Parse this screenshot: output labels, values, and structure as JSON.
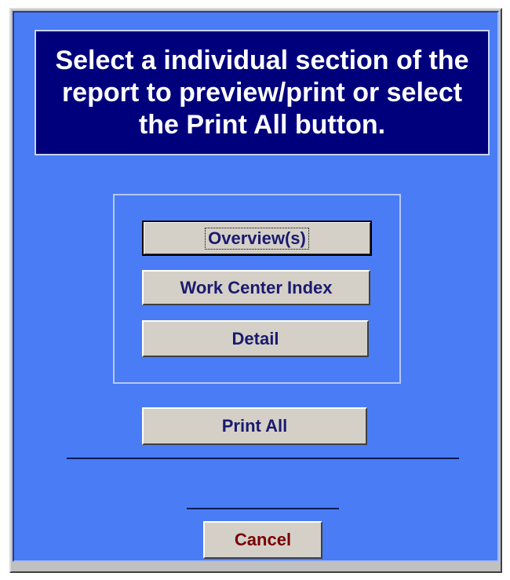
{
  "header": {
    "instruction_text": "Select a individual section of the report to preview/print or select the Print All button."
  },
  "sections": {
    "overview_label": "Overview(s)",
    "work_center_index_label": "Work Center Index",
    "detail_label": "Detail"
  },
  "actions": {
    "print_all_label": "Print All",
    "cancel_label": "Cancel"
  },
  "colors": {
    "panel_background": "#4a7cf6",
    "header_background": "#00007d",
    "button_face": "#d4d0c8",
    "button_text": "#1a1a6e",
    "cancel_text": "#7a0000"
  }
}
